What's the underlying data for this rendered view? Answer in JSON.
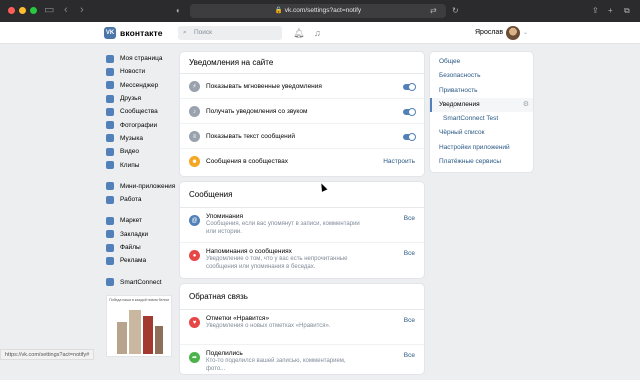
{
  "browser": {
    "url": "vk.com/settings?act=notify",
    "status_url": "https://vk.com/settings?act=notify#"
  },
  "header": {
    "logo_mark": "VK",
    "logo": "вконтакте",
    "search_placeholder": "Поиск",
    "user_name": "Ярослав"
  },
  "left_menu": {
    "main": [
      "Моя страница",
      "Новости",
      "Мессенджер",
      "Друзья",
      "Сообщества",
      "Фотографии",
      "Музыка",
      "Видео",
      "Клипы"
    ],
    "apps": [
      "Мини-приложения",
      "Работа"
    ],
    "more": [
      "Маркет",
      "Закладки",
      "Файлы",
      "Реклама"
    ],
    "extra": [
      "SmartConnect"
    ],
    "ad_caption": "Победа наша в каждой новом белом"
  },
  "notify_card": {
    "title": "Уведомления на сайте",
    "rows": [
      {
        "label": "Показывать мгновенные уведомления",
        "toggle": true
      },
      {
        "label": "Получать уведомления со звуком",
        "toggle": true
      },
      {
        "label": "Показывать текст сообщений",
        "toggle": true
      },
      {
        "label": "Сообщения в сообществах",
        "action": "Настроить"
      }
    ]
  },
  "messages_card": {
    "title": "Сообщения",
    "rows": [
      {
        "label": "Упоминания",
        "desc": "Сообщения, если вас упомянут в записи, комментарии или истории.",
        "action": "Все"
      },
      {
        "label": "Напоминания о сообщениях",
        "desc": "Уведомление о том, что у вас есть непрочитанные сообщения или упоминания в беседах.",
        "action": "Все"
      }
    ]
  },
  "feedback_card": {
    "title": "Обратная связь",
    "rows": [
      {
        "label": "Отметки «Нравится»",
        "desc": "Уведомления о новых отметках «Нравится».",
        "action": "Все"
      },
      {
        "label": "Поделились",
        "desc": "Кто-то поделился вашей записью, комментарием, фото...",
        "action": "Все"
      }
    ]
  },
  "right_nav": {
    "items": [
      "Общее",
      "Безопасность",
      "Приватность",
      "Уведомления",
      "SmartConnect Test",
      "Чёрный список",
      "Настройки приложений",
      "Платёжные сервисы"
    ]
  },
  "colors": {
    "accent": "#5181b8",
    "link": "#2a5885",
    "background": "#edeef0"
  }
}
